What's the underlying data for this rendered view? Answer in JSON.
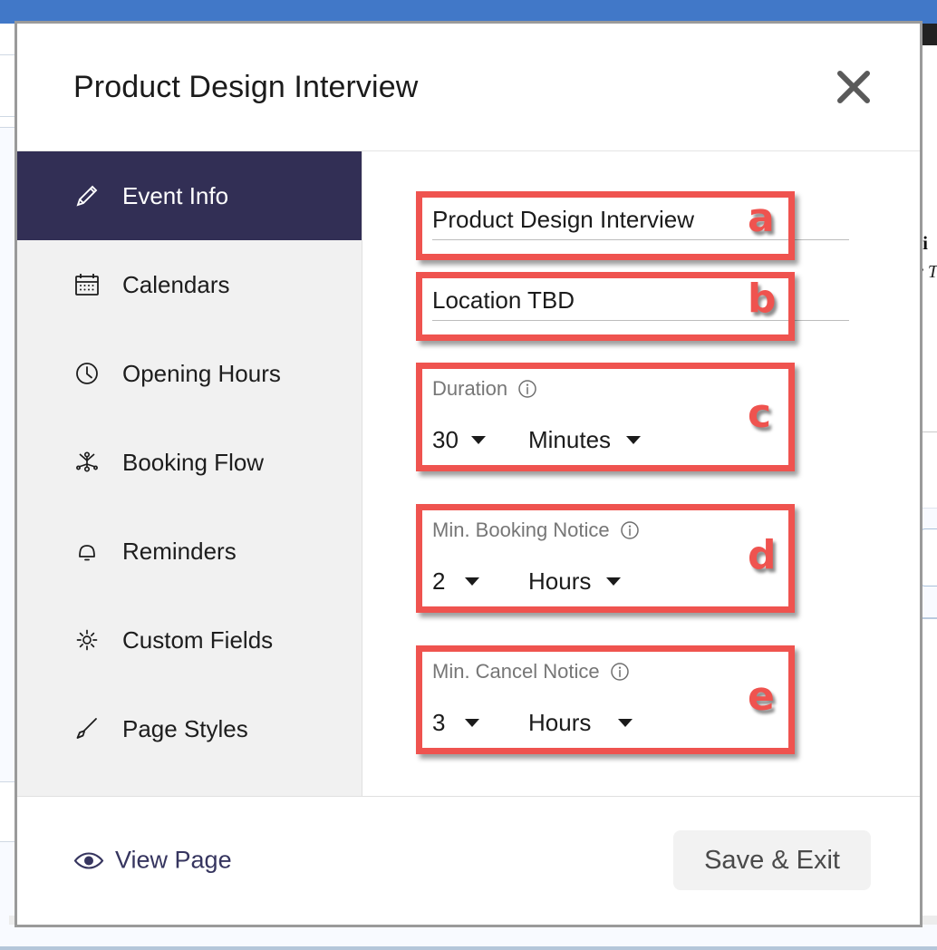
{
  "modal": {
    "title": "Product Design Interview",
    "close_icon": "close-icon"
  },
  "sidebar": {
    "items": [
      {
        "label": "Event Info",
        "icon": "pencil-icon",
        "active": true
      },
      {
        "label": "Calendars",
        "icon": "calendar-icon",
        "active": false
      },
      {
        "label": "Opening Hours",
        "icon": "clock-icon",
        "active": false
      },
      {
        "label": "Booking Flow",
        "icon": "flow-icon",
        "active": false
      },
      {
        "label": "Reminders",
        "icon": "bell-icon",
        "active": false
      },
      {
        "label": "Custom Fields",
        "icon": "gear-icon",
        "active": false
      },
      {
        "label": "Page Styles",
        "icon": "brush-icon",
        "active": false
      }
    ]
  },
  "form": {
    "event_name": {
      "value": "Product Design Interview"
    },
    "location": {
      "value": "Location TBD"
    },
    "duration": {
      "label": "Duration",
      "amount": "30",
      "unit": "Minutes",
      "info_icon": "info-icon"
    },
    "min_booking_notice": {
      "label": "Min. Booking Notice",
      "amount": "2",
      "unit": "Hours",
      "info_icon": "info-icon"
    },
    "min_cancel_notice": {
      "label": "Min. Cancel Notice",
      "amount": "3",
      "unit": "Hours",
      "info_icon": "info-icon"
    }
  },
  "annotations": {
    "a": "a",
    "b": "b",
    "c": "c",
    "d": "d",
    "e": "e"
  },
  "footer": {
    "view_page_label": "View Page",
    "view_page_icon": "eye-icon",
    "save_label": "Save & Exit"
  },
  "background": {
    "partial_text_1": "si",
    "partial_text_2": "v T"
  },
  "colors": {
    "topbar_blue": "#4178c8",
    "sidebar_active": "#322f55",
    "annotation_red": "#ef534f",
    "link_navy": "#36355f"
  }
}
